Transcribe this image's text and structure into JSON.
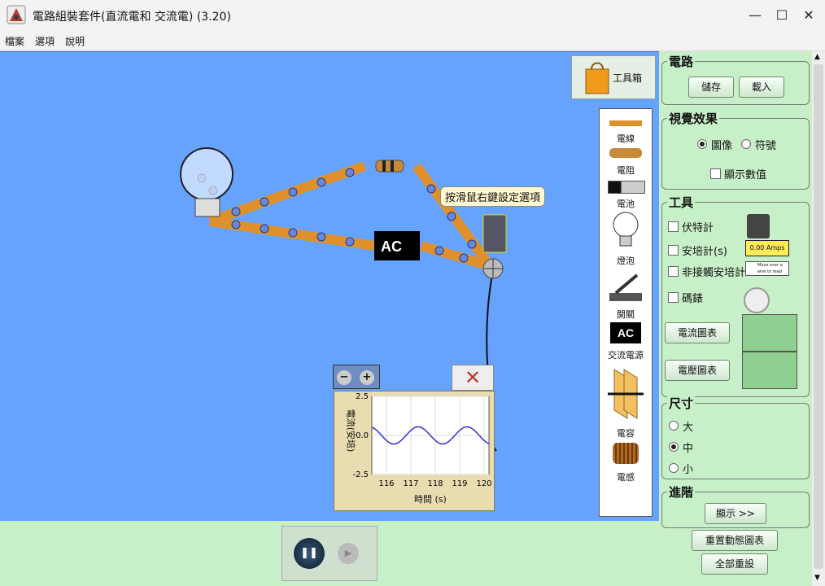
{
  "window": {
    "title": "電路組裝套件(直流電和 交流電) (3.20)",
    "minimize": "—",
    "maximize": "☐",
    "close": "✕"
  },
  "menu": {
    "file": "檔案",
    "options": "選項",
    "help": "說明"
  },
  "canvas": {
    "toolbox_label": "工具箱",
    "tooltip": "按滑鼠右鍵設定選項",
    "ac_label": "AC",
    "palette": {
      "wire": "電線",
      "resistor": "電阻",
      "battery": "電池",
      "bulb": "燈泡",
      "switch": "開關",
      "ac_source": "交流電源",
      "ac_icon": "AC",
      "capacitor": "電容",
      "inductor": "電感"
    }
  },
  "chart_data": {
    "type": "line",
    "title": "",
    "xlabel": "時間 (s)",
    "ylabel": "電流(安培)",
    "xlim": [
      115.4,
      120.2
    ],
    "ylim": [
      -2.5,
      2.5
    ],
    "yticks": [
      "2.5",
      "0.0",
      "-2.5"
    ],
    "xticks": [
      "116",
      "117",
      "118",
      "119",
      "120"
    ],
    "grid": true,
    "series": [
      {
        "amplitude": 0.55,
        "period": 2.0,
        "phase_at": 116.3,
        "color": "#3030d0"
      }
    ]
  },
  "right_panel": {
    "circuit": {
      "title": "電路",
      "save": "儲存",
      "load": "載入"
    },
    "visual": {
      "title": "視覺效果",
      "image": "圖像",
      "symbol": "符號",
      "show_values": "顯示數值"
    },
    "tools": {
      "title": "工具",
      "voltmeter": "伏特計",
      "ammeter": "安培計(s)",
      "noncontact": "非接觸安培計",
      "stopwatch": "碼錶",
      "current_chart": "電流圖表",
      "voltage_chart": "電壓圖表",
      "amp_readout": "0.00 Amps",
      "noncontact_hint": "Move over a wire to read current."
    },
    "size": {
      "title": "尺寸",
      "large": "大",
      "medium": "中",
      "small": "小"
    },
    "advanced": {
      "title": "進階",
      "show": "顯示 >>"
    },
    "reset_charts": "重置動態圖表",
    "reset_all": "全部重設"
  },
  "colors": {
    "canvas": "#66a3ff",
    "panel": "#c8f0c8",
    "wire": "#e0902a"
  }
}
